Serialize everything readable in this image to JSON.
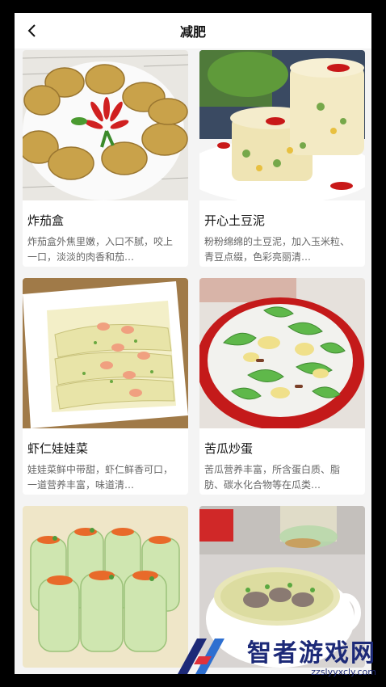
{
  "header": {
    "title": "减肥",
    "back_icon": "chevron-left-icon"
  },
  "recipes": [
    {
      "title": "炸茄盒",
      "desc": "炸茄盒外焦里嫩，入口不腻，咬上一口，淡淡的肉香和茄…"
    },
    {
      "title": "开心土豆泥",
      "desc": "粉粉绵绵的土豆泥，加入玉米粒、青豆点缀，色彩亮丽清…"
    },
    {
      "title": "虾仁娃娃菜",
      "desc": "娃娃菜鲜中带甜，虾仁鲜香可口，一道营养丰富，味道清…"
    },
    {
      "title": "苦瓜炒蛋",
      "desc": "苦瓜营养丰富，所含蛋白质、脂肪、碳水化合物等在瓜类…"
    }
  ],
  "watermark": {
    "name": "智者游戏网",
    "url": "zzslyyxcly.com"
  },
  "colors": {
    "background": "#f4f4f4",
    "card": "#ffffff",
    "watermark": "#1d2a78"
  }
}
